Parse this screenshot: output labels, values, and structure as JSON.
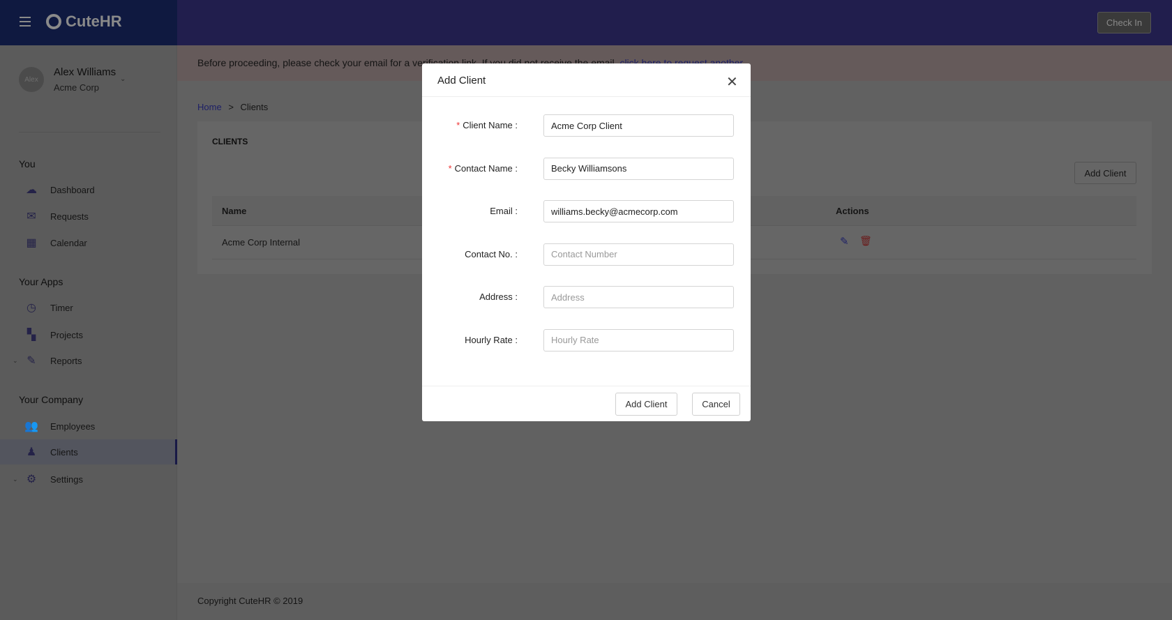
{
  "header": {
    "logo": "CuteHR",
    "check_in": "Check In"
  },
  "user": {
    "avatar": "Alex",
    "name": "Alex Williams",
    "company": "Acme Corp"
  },
  "sidebar": {
    "sections": [
      {
        "label": "You"
      },
      {
        "label": "Your Apps"
      },
      {
        "label": "Your Company"
      }
    ],
    "items": [
      {
        "label": "Dashboard",
        "icon": "dashboard-icon"
      },
      {
        "label": "Requests",
        "icon": "mail-icon"
      },
      {
        "label": "Calendar",
        "icon": "calendar-icon"
      },
      {
        "label": "Timer",
        "icon": "clock-icon"
      },
      {
        "label": "Projects",
        "icon": "grid-icon"
      },
      {
        "label": "Reports",
        "icon": "edit-icon"
      },
      {
        "label": "Employees",
        "icon": "users-icon"
      },
      {
        "label": "Clients",
        "icon": "person-icon",
        "active": true
      },
      {
        "label": "Settings",
        "icon": "gear-icon"
      }
    ]
  },
  "banner": {
    "text": "Before proceeding, please check your email for a verification link. If you did not receive the email, ",
    "link": "click here to request another",
    "end": "."
  },
  "breadcrumb": {
    "home": "Home",
    "sep": ">",
    "current": "Clients"
  },
  "card": {
    "title": "CLIENTS",
    "add_button": "Add Client",
    "columns": [
      "Name",
      "Actions"
    ],
    "rows": [
      {
        "name": "Acme Corp Internal"
      }
    ]
  },
  "footer": {
    "text": "Copyright CuteHR © 2019"
  },
  "modal": {
    "title": "Add Client",
    "fields": [
      {
        "label": "Client Name :",
        "required": true,
        "value": "Acme Corp Client",
        "placeholder": ""
      },
      {
        "label": "Contact Name :",
        "required": true,
        "value": "Becky Williamsons",
        "placeholder": ""
      },
      {
        "label": "Email :",
        "required": false,
        "value": "williams.becky@acmecorp.com",
        "placeholder": ""
      },
      {
        "label": "Contact No. :",
        "required": false,
        "value": "",
        "placeholder": "Contact Number"
      },
      {
        "label": "Address :",
        "required": false,
        "value": "",
        "placeholder": "Address"
      },
      {
        "label": "Hourly Rate :",
        "required": false,
        "value": "",
        "placeholder": "Hourly Rate"
      }
    ],
    "submit": "Add Client",
    "cancel": "Cancel"
  },
  "colors": {
    "primary": "#3b3fb0",
    "danger": "#e33333"
  }
}
